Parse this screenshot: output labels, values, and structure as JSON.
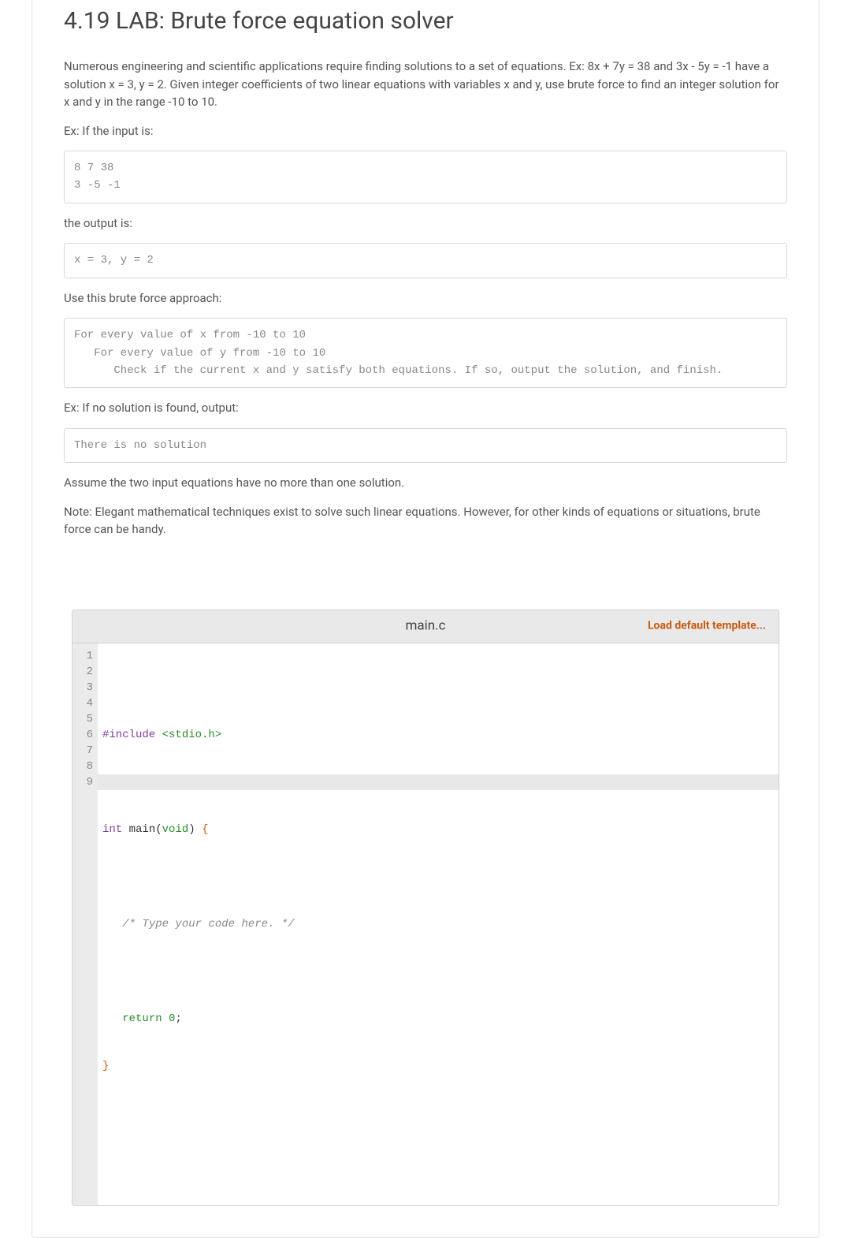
{
  "title": "4.19 LAB: Brute force equation solver",
  "paragraphs": {
    "intro": "Numerous engineering and scientific applications require finding solutions to a set of equations. Ex: 8x + 7y = 38 and 3x - 5y = -1 have a solution x = 3, y = 2. Given integer coefficients of two linear equations with variables x and y, use brute force to find an integer solution for x and y in the range -10 to 10.",
    "ex_input_label": "Ex: If the input is:",
    "output_label": "the output is:",
    "approach_label": "Use this brute force approach:",
    "no_solution_label": "Ex: If no solution is found, output:",
    "assume": "Assume the two input equations have no more than one solution.",
    "note": "Note: Elegant mathematical techniques exist to solve such linear equations. However, for other kinds of equations or situations, brute force can be handy."
  },
  "code_blocks": {
    "input_example": "8 7 38\n3 -5 -1",
    "output_example": "x = 3, y = 2",
    "approach": "For every value of x from -10 to 10\n   For every value of y from -10 to 10\n      Check if the current x and y satisfy both equations. If so, output the solution, and finish.",
    "no_solution": "There is no solution"
  },
  "editor": {
    "filename": "main.c",
    "load_template_label": "Load default template...",
    "cursor_line": 9,
    "lines": {
      "l1": {
        "pp": "#include ",
        "str": "<stdio.h>"
      },
      "l2": "",
      "l3": {
        "type": "int",
        "sp1": " ",
        "fn": "main(",
        "kw": "void",
        "close": ") ",
        "brace": "{"
      },
      "l4": "",
      "l5": {
        "indent": "   ",
        "comment": "/* Type your code here. */"
      },
      "l6": "",
      "l7": {
        "indent": "   ",
        "kw": "return",
        "sp": " ",
        "num": "0",
        "semi": ";"
      },
      "l8": {
        "brace": "}"
      },
      "l9": ""
    },
    "line_numbers": [
      "1",
      "2",
      "3",
      "4",
      "5",
      "6",
      "7",
      "8",
      "9"
    ]
  }
}
